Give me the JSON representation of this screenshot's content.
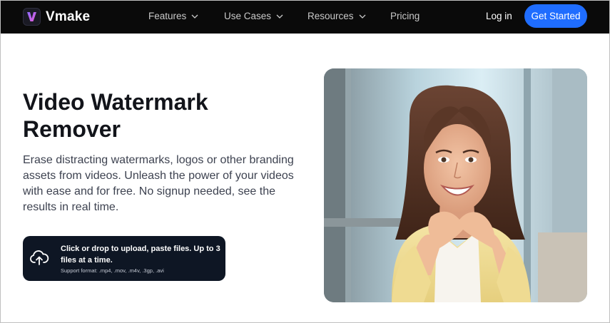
{
  "brand": {
    "name": "Vmake",
    "logo_icon": "vmake-logo-icon"
  },
  "nav": {
    "items": [
      {
        "label": "Features",
        "has_dropdown": true
      },
      {
        "label": "Use Cases",
        "has_dropdown": true
      },
      {
        "label": "Resources",
        "has_dropdown": true
      },
      {
        "label": "Pricing",
        "has_dropdown": false
      }
    ],
    "login_label": "Log in",
    "cta_label": "Get Started"
  },
  "hero": {
    "title": "Video Watermark Remover",
    "description": "Erase distracting watermarks, logos or other branding assets from videos. Unleash the power of your videos with ease and for free. No signup needed, see the results in real time.",
    "upload": {
      "icon": "cloud-upload-icon",
      "label": "Click or drop to upload, paste files. Up to 3 files at a time.",
      "support": "Support format: .mp4, .mov, .m4v, .3gp, .avi"
    },
    "image": "smiling-woman-photo"
  },
  "colors": {
    "nav_bg": "#0a0a0a",
    "cta_blue": "#1f6dff",
    "upload_bg": "#0e1624",
    "title": "#12141a",
    "text": "#3d4250"
  }
}
